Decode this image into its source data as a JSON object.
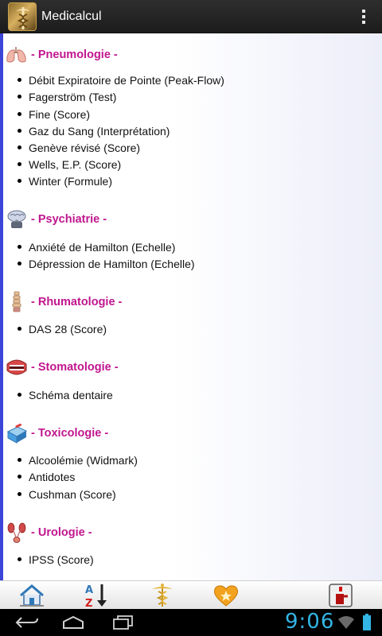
{
  "app": {
    "title": "Medicalcul",
    "icon": "caduceus-app-icon"
  },
  "sections": [
    {
      "title": "- Pneumologie -",
      "icon": "lungs-icon",
      "items": [
        "Débit Expiratoire de Pointe (Peak-Flow)",
        "Fagerström (Test)",
        "Fine (Score)",
        "Gaz du Sang (Interprétation)",
        "Genève révisé (Score)",
        "Wells, E.P. (Score)",
        "Winter (Formule)"
      ]
    },
    {
      "title": "- Psychiatrie -",
      "icon": "brain-icon",
      "items": [
        "Anxiété de Hamilton (Echelle)",
        "Dépression de Hamilton (Echelle)"
      ]
    },
    {
      "title": "- Rhumatologie -",
      "icon": "spine-icon",
      "items": [
        "DAS 28 (Score)"
      ]
    },
    {
      "title": "- Stomatologie -",
      "icon": "mouth-icon",
      "items": [
        "Schéma dentaire"
      ]
    },
    {
      "title": "- Toxicologie -",
      "icon": "pill-box-icon",
      "items": [
        "Alcoolémie (Widmark)",
        "Antidotes",
        "Cushman (Score)"
      ]
    },
    {
      "title": "- Urologie -",
      "icon": "kidneys-icon",
      "items": [
        "IPSS (Score)"
      ]
    }
  ],
  "toolbar": [
    "home-icon",
    "sort-az-icon",
    "caduceus-icon",
    "favorites-heart-icon",
    "emergency-icon"
  ],
  "navbar": {
    "clock": "9:06",
    "icons": [
      "back-icon",
      "home-nav-icon",
      "recent-apps-icon",
      "wifi-icon",
      "battery-icon"
    ]
  },
  "colors": {
    "section_title": "#c0168e",
    "content_edge": "#3b45d8",
    "clock": "#33b5e5"
  }
}
